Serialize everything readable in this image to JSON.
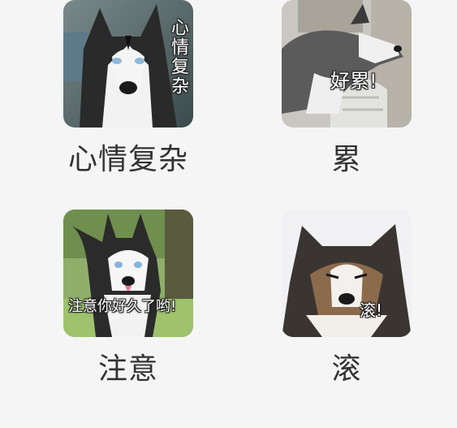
{
  "stickers": [
    {
      "caption": "心情复杂",
      "overlay": "心情复杂",
      "icon": "husky-photo"
    },
    {
      "caption": "累",
      "overlay": "好累!",
      "icon": "husky-photo"
    },
    {
      "caption": "注意",
      "overlay": "注意你好久了哟!",
      "icon": "husky-photo"
    },
    {
      "caption": "滚",
      "overlay": "滚!",
      "icon": "husky-photo"
    }
  ]
}
